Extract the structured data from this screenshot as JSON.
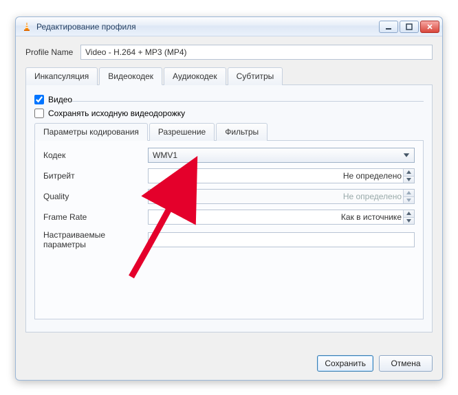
{
  "window": {
    "title": "Редактирование профиля"
  },
  "profile": {
    "label": "Profile Name",
    "value": "Video - H.264 + MP3 (MP4)"
  },
  "tabs": {
    "encapsulation": "Инкапсуляция",
    "videocodec": "Видеокодек",
    "audiocodec": "Аудиокодек",
    "subtitles": "Субтитры"
  },
  "video": {
    "video_checkbox": "Видео",
    "keep_original": "Сохранять исходную видеодорожку"
  },
  "subtabs": {
    "params": "Параметры кодирования",
    "resolution": "Разрешение",
    "filters": "Фильтры"
  },
  "fields": {
    "codec_label": "Кодек",
    "codec_value": "WMV1",
    "bitrate_label": "Битрейт",
    "bitrate_value": "Не определено",
    "quality_label": "Quality",
    "quality_value": "Не определено",
    "framerate_label": "Frame Rate",
    "framerate_value": "Как в источнике",
    "custom_label": "Настраиваемые параметры"
  },
  "buttons": {
    "save": "Сохранить",
    "cancel": "Отмена"
  }
}
